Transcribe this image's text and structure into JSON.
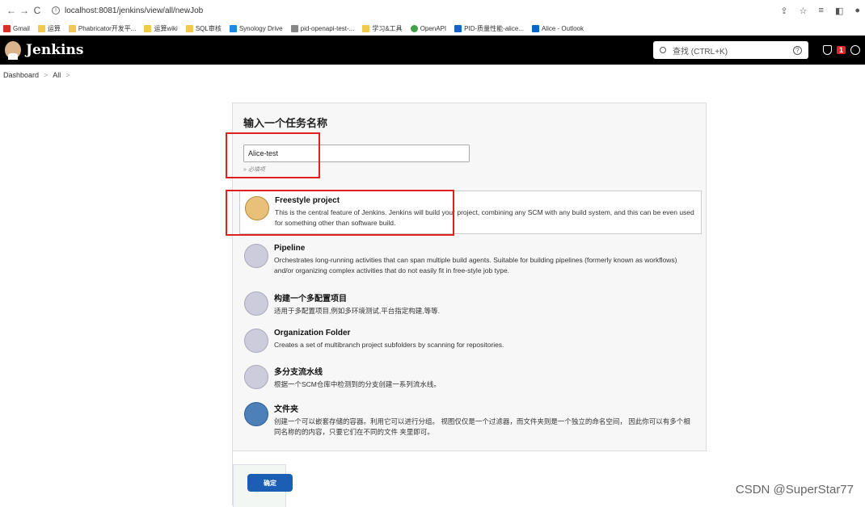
{
  "browser": {
    "url": "localhost:8081/jenkins/view/all/newJob",
    "bookmarks": [
      "Gmail",
      "运算",
      "Phabricator开发平...",
      "运算wiki",
      "SQL审核",
      "Synology Drive",
      "pid-openapi-test-...",
      "学习&工具",
      "OpenAPI",
      "PID-质量性能-alice...",
      "Alice - Outlook"
    ]
  },
  "header": {
    "title": "Jenkins",
    "search_placeholder": "查找 (CTRL+K)",
    "badge_count": "1"
  },
  "breadcrumb": [
    "Dashboard",
    "All"
  ],
  "form": {
    "title": "输入一个任务名称",
    "name_value": "Alice-test",
    "required_hint": "» 必填项"
  },
  "items": [
    {
      "title": "Freestyle project",
      "desc": "This is the central feature of Jenkins. Jenkins will build your project, combining any SCM with any build system, and this can be even used for something other than software build."
    },
    {
      "title": "Pipeline",
      "desc": "Orchestrates long-running activities that can span multiple build agents. Suitable for building pipelines (formerly known as workflows) and/or organizing complex activities that do not easily fit in free-style job type."
    },
    {
      "title": "构建一个多配置项目",
      "desc": "适用于多配置项目,例如多环境测试,平台指定构建,等等."
    },
    {
      "title": "Organization Folder",
      "desc": "Creates a set of multibranch project subfolders by scanning for repositories."
    },
    {
      "title": "多分支流水线",
      "desc": "根据一个SCM仓库中检测到的分支创建一系列流水线。"
    },
    {
      "title": "文件夹",
      "desc": "创建一个可以嵌套存储的容器。利用它可以进行分组。 视图仅仅是一个过滤器，而文件夹则是一个独立的命名空间， 因此你可以有多个相同名称的的内容，只要它们在不同的文件 夹里即可。"
    }
  ],
  "ok_label": "确定",
  "watermark": "CSDN @SuperStar77",
  "colors": {
    "accent": "#1a5fb4",
    "header_bg": "#000000",
    "highlight": "#e02020"
  }
}
